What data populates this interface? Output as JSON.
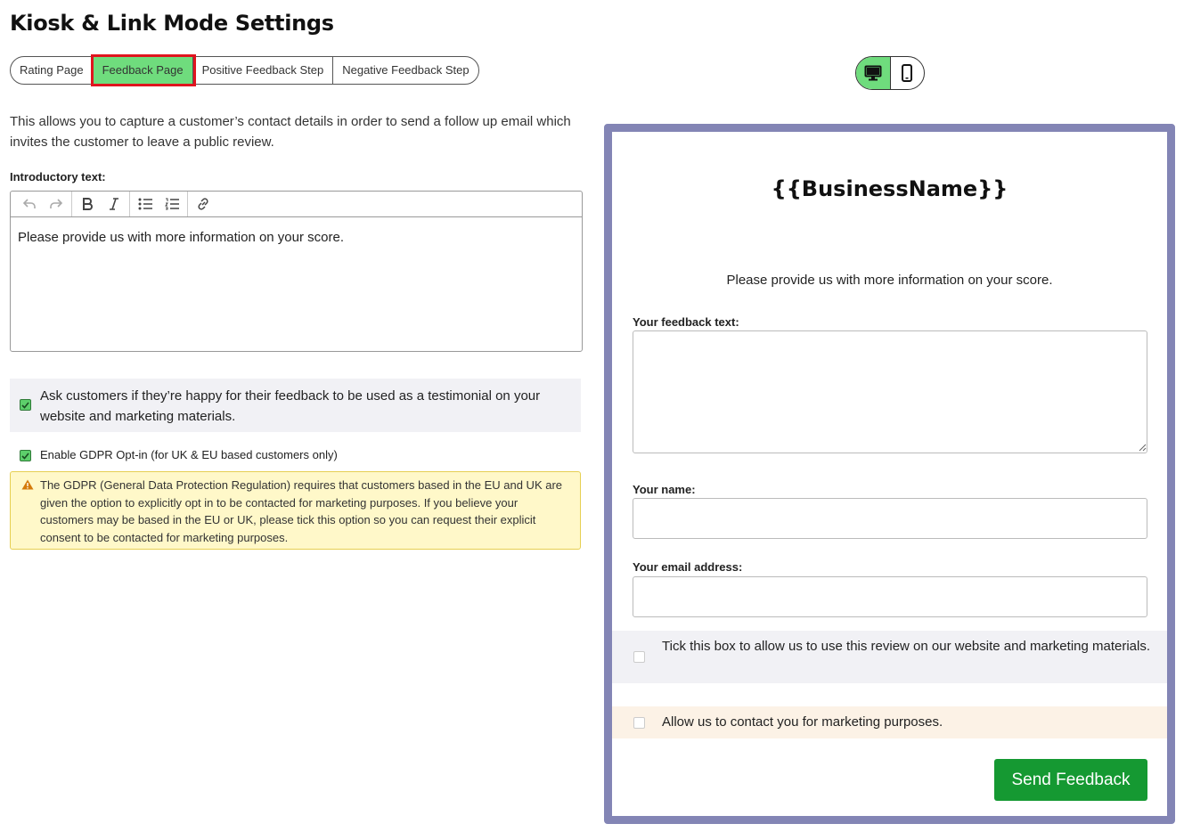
{
  "page": {
    "title": "Kiosk & Link Mode Settings"
  },
  "tabs": [
    {
      "label": "Rating Page",
      "active": false
    },
    {
      "label": "Feedback Page",
      "active": true
    },
    {
      "label": "Positive Feedback Step",
      "active": false
    },
    {
      "label": "Negative Feedback Step",
      "active": false
    }
  ],
  "device_toggle": {
    "selected": "desktop",
    "options": [
      "desktop-icon",
      "mobile-icon"
    ]
  },
  "settings": {
    "description": "This allows you to capture a customer’s contact details in order to send a follow up email which invites the customer to leave a public review.",
    "intro_label": "Introductory text:",
    "intro_text": "Please provide us with more information on your score.",
    "toolbar_icons": [
      "undo-icon",
      "redo-icon",
      "bold-icon",
      "italic-icon",
      "bullet-list-icon",
      "numbered-list-icon",
      "link-icon"
    ],
    "testimonial_checked": true,
    "testimonial_text": "Ask customers if they’re happy for their feedback to be used as a testimonial on your website and marketing materials.",
    "gdpr_checked": true,
    "gdpr_text": "Enable GDPR Opt-in (for UK & EU based customers only)",
    "gdpr_warning": "The GDPR (General Data Protection Regulation) requires that customers based in the EU and UK are given the option to explicitly opt in to be contacted for marketing purposes. If you believe your customers may be based in the EU or UK, please tick this option so you can request their explicit consent to be contacted for marketing purposes."
  },
  "preview": {
    "business_name": "{{BusinessName}}",
    "intro_text": "Please provide us with more information on your score.",
    "feedback_label": "Your feedback text:",
    "feedback_value": "",
    "name_label": "Your name:",
    "name_value": "",
    "email_label": "Your email address:",
    "email_value": "",
    "testimonial_consent": "Tick this box to allow us to use this review on our website and marketing materials.",
    "marketing_consent": "Allow us to contact you for marketing purposes.",
    "send_button": "Send Feedback"
  },
  "colors": {
    "active_tab": "#6fdc7d",
    "highlight_outline": "#e0141e",
    "preview_frame": "#8385b5",
    "send_button": "#159932",
    "warning_bg": "#fff8c9"
  }
}
